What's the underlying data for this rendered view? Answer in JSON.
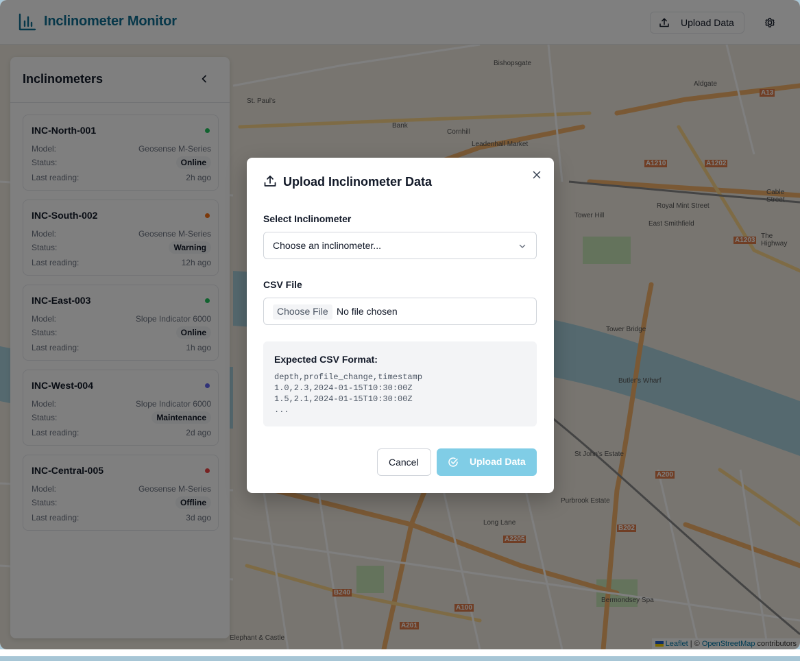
{
  "app": {
    "title": "Inclinometer Monitor",
    "header_upload_label": "Upload Data",
    "logo_icon": "bar-chart-icon",
    "settings_icon": "gear-icon",
    "brand_color": "#0e6f92"
  },
  "sidebar": {
    "title": "Inclinometers",
    "collapse_icon": "chevron-left-icon",
    "labels": {
      "model": "Model:",
      "status": "Status:",
      "last_reading": "Last reading:"
    },
    "items": [
      {
        "name": "INC-North-001",
        "model": "Geosense M-Series",
        "status": "Online",
        "last_reading": "2h ago",
        "dot_color": "#22c55e"
      },
      {
        "name": "INC-South-002",
        "model": "Geosense M-Series",
        "status": "Warning",
        "last_reading": "12h ago",
        "dot_color": "#f97316"
      },
      {
        "name": "INC-East-003",
        "model": "Slope Indicator 6000",
        "status": "Online",
        "last_reading": "1h ago",
        "dot_color": "#22c55e"
      },
      {
        "name": "INC-West-004",
        "model": "Slope Indicator 6000",
        "status": "Maintenance",
        "last_reading": "2d ago",
        "dot_color": "#6366f1"
      },
      {
        "name": "INC-Central-005",
        "model": "Geosense M-Series",
        "status": "Offline",
        "last_reading": "3d ago",
        "dot_color": "#ef4444"
      }
    ]
  },
  "map": {
    "labels": [
      "Bishopsgate",
      "St. Paul's",
      "Aldgate",
      "Bank",
      "Cornhill",
      "Leadenhall Market",
      "Tower Hill",
      "East Smithfield",
      "Royal Mint Street",
      "Tower Bridge",
      "Butler's Wharf",
      "St John's Estate",
      "Long Lane",
      "Bermondsey Spa",
      "Purbrook Estate",
      "Elephant & Castle",
      "The Highway",
      "Cable Street",
      "A1210",
      "A1202",
      "A1203",
      "A200",
      "B202",
      "A2205",
      "A100",
      "B240",
      "A201",
      "A13"
    ],
    "attribution": {
      "leaflet": "Leaflet",
      "separator": " | © ",
      "osm": "OpenStreetMap",
      "suffix": " contributors"
    }
  },
  "modal": {
    "title": "Upload Inclinometer Data",
    "title_icon": "upload-icon",
    "close_icon": "close-icon",
    "select_label": "Select Inclinometer",
    "select_placeholder": "Choose an inclinometer...",
    "file_label": "CSV File",
    "file_button": "Choose File",
    "file_status": "No file chosen",
    "format_heading": "Expected CSV Format:",
    "format_lines": [
      "depth,profile_change,timestamp",
      "1.0,2.3,2024-01-15T10:30:00Z",
      "1.5,2.1,2024-01-15T10:30:00Z",
      "..."
    ],
    "cancel_label": "Cancel",
    "upload_label": "Upload Data",
    "upload_color": "#80cde6"
  }
}
